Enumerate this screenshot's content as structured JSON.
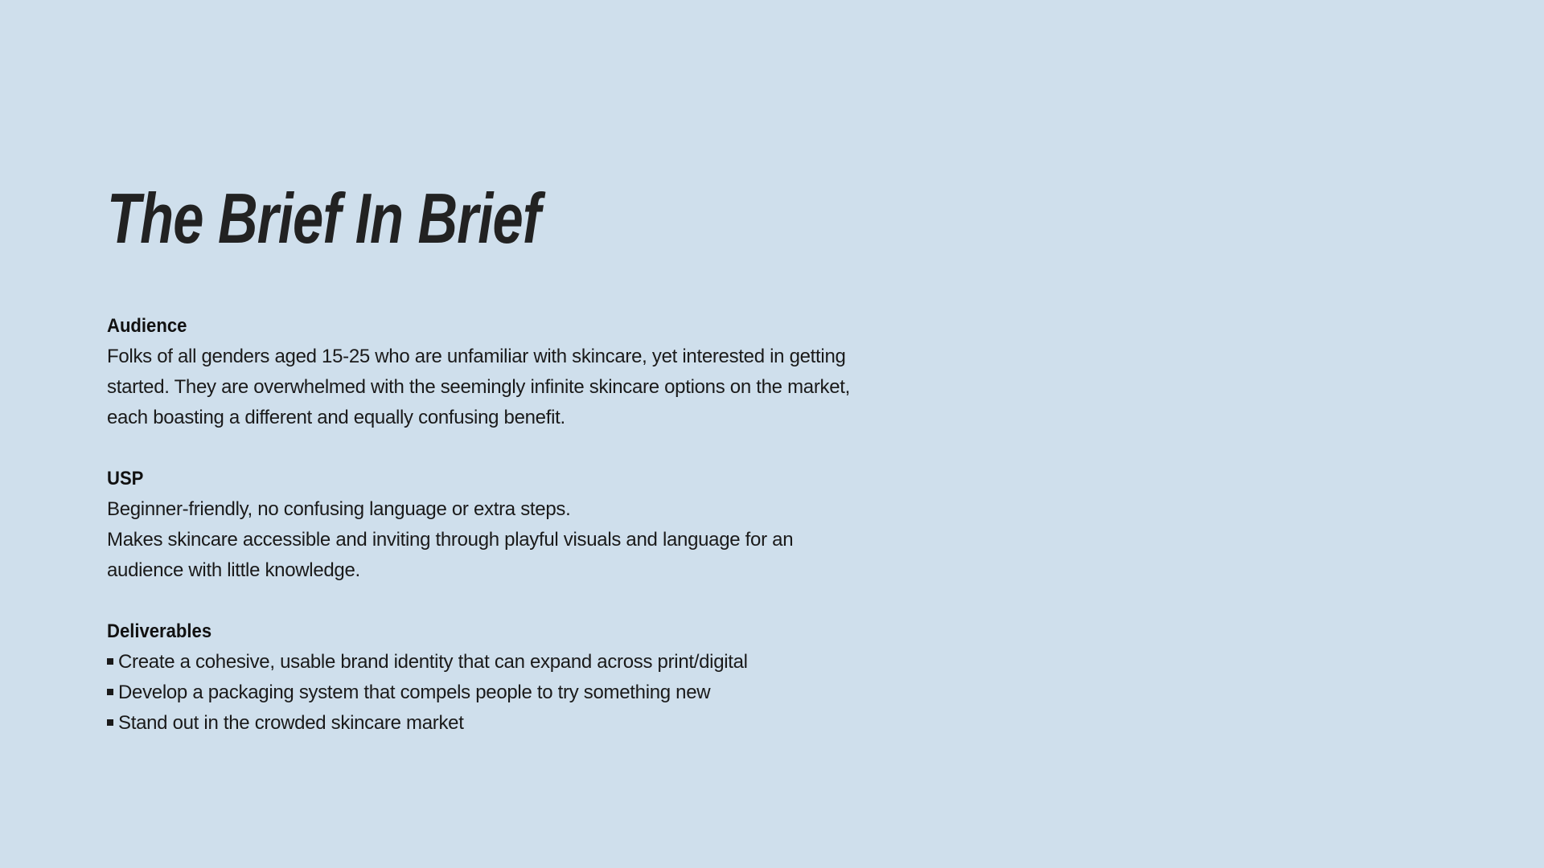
{
  "title": "The Brief In Brief",
  "audience": {
    "heading": "Audience",
    "body": "Folks of all genders aged 15-25 who are unfamiliar with skincare, yet interested in getting started. They are overwhelmed with the seemingly infinite skincare options on the market, each boasting a different and equally confusing benefit."
  },
  "usp": {
    "heading": "USP",
    "lines": [
      "Beginner-friendly, no confusing language or extra steps.",
      "Makes skincare accessible and inviting through playful visuals and language for an audience with little knowledge."
    ]
  },
  "deliverables": {
    "heading": "Deliverables",
    "items": [
      "Create a cohesive, usable brand identity that can expand across print/digital",
      "Develop a packaging system that compels people to try something new",
      "Stand out in the crowded skincare market"
    ]
  },
  "colors": {
    "background": "#cfdfec",
    "text": "#1a1a1a"
  }
}
